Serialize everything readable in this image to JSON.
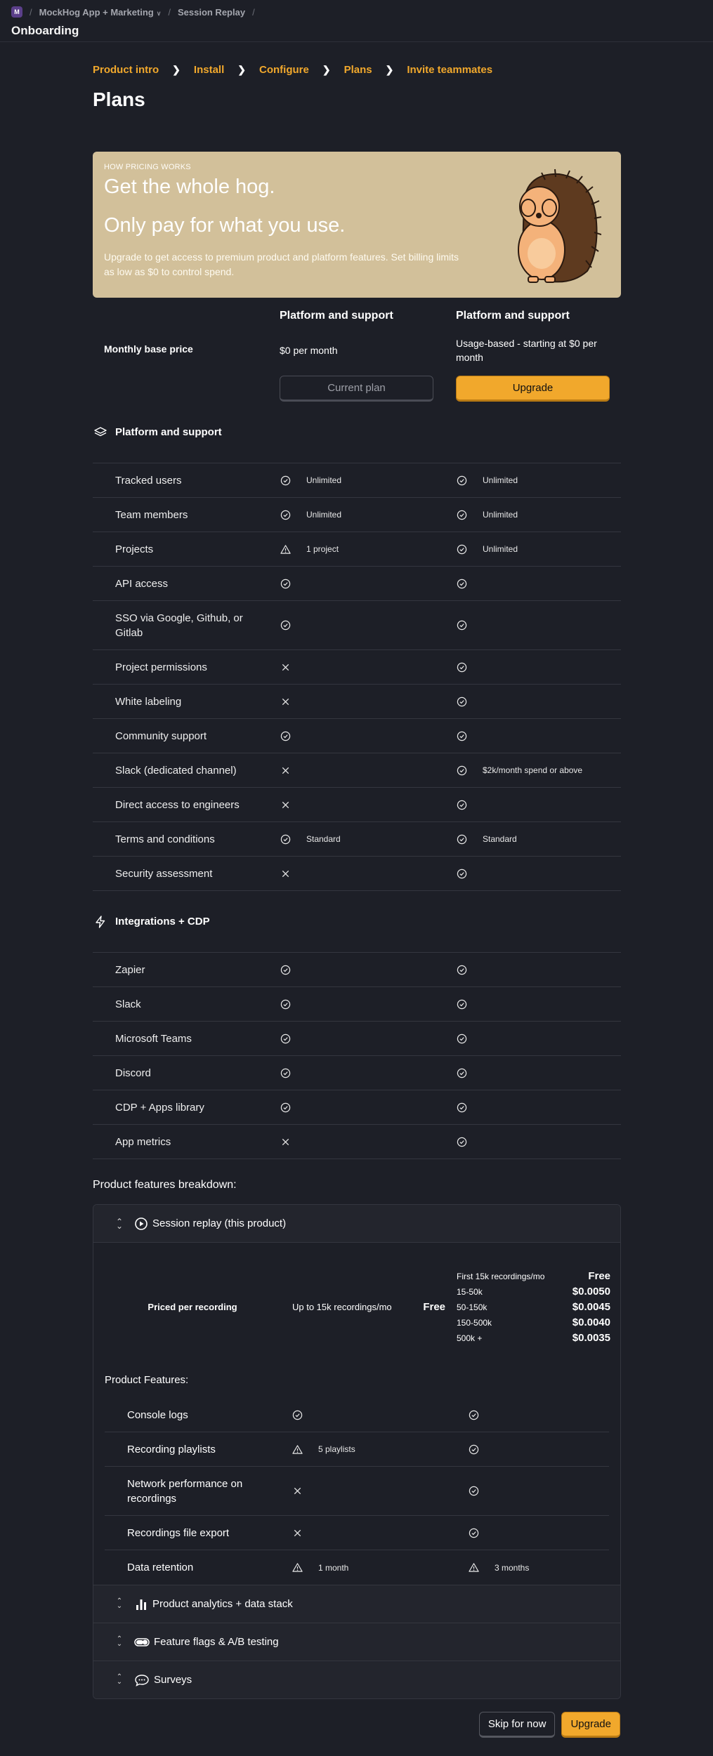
{
  "topbar": {
    "org_initial": "M",
    "breadcrumbs": [
      "MockHog App + Marketing",
      "Session Replay"
    ],
    "page_title": "Onboarding"
  },
  "steps": [
    "Product intro",
    "Install",
    "Configure",
    "Plans",
    "Invite teammates"
  ],
  "title": "Plans",
  "hero": {
    "eyebrow": "HOW PRICING WORKS",
    "headline1": "Get the whole hog.",
    "headline2": "Only pay for what you use.",
    "description": "Upgrade to get access to premium product and platform features. Set billing limits as low as $0 to control spend."
  },
  "plans": {
    "columns": [
      "Platform and support",
      "Platform and support"
    ],
    "base_price_label": "Monthly base price",
    "prices": [
      "$0 per month",
      "Usage-based - starting at $0 per month"
    ],
    "current_label": "Current plan",
    "upgrade_label": "Upgrade"
  },
  "sections": [
    {
      "title": "Platform and support",
      "icon": "stack-icon",
      "rows": [
        {
          "name": "Tracked users",
          "free": {
            "icon": "check",
            "text": "Unlimited"
          },
          "paid": {
            "icon": "check",
            "text": "Unlimited"
          }
        },
        {
          "name": "Team members",
          "free": {
            "icon": "check",
            "text": "Unlimited"
          },
          "paid": {
            "icon": "check",
            "text": "Unlimited"
          }
        },
        {
          "name": "Projects",
          "free": {
            "icon": "warning",
            "text": "1 project"
          },
          "paid": {
            "icon": "check",
            "text": "Unlimited"
          }
        },
        {
          "name": "API access",
          "free": {
            "icon": "check",
            "text": ""
          },
          "paid": {
            "icon": "check",
            "text": ""
          }
        },
        {
          "name": "SSO via Google, Github, or Gitlab",
          "free": {
            "icon": "check",
            "text": ""
          },
          "paid": {
            "icon": "check",
            "text": ""
          }
        },
        {
          "name": "Project permissions",
          "free": {
            "icon": "x",
            "text": ""
          },
          "paid": {
            "icon": "check",
            "text": ""
          }
        },
        {
          "name": "White labeling",
          "free": {
            "icon": "x",
            "text": ""
          },
          "paid": {
            "icon": "check",
            "text": ""
          }
        },
        {
          "name": "Community support",
          "free": {
            "icon": "check",
            "text": ""
          },
          "paid": {
            "icon": "check",
            "text": ""
          }
        },
        {
          "name": "Slack (dedicated channel)",
          "free": {
            "icon": "x",
            "text": ""
          },
          "paid": {
            "icon": "check",
            "text": "$2k/month spend or above"
          }
        },
        {
          "name": "Direct access to engineers",
          "free": {
            "icon": "x",
            "text": ""
          },
          "paid": {
            "icon": "check",
            "text": ""
          }
        },
        {
          "name": "Terms and conditions",
          "free": {
            "icon": "check",
            "text": "Standard"
          },
          "paid": {
            "icon": "check",
            "text": "Standard"
          }
        },
        {
          "name": "Security assessment",
          "free": {
            "icon": "x",
            "text": ""
          },
          "paid": {
            "icon": "check",
            "text": ""
          }
        }
      ]
    },
    {
      "title": "Integrations + CDP",
      "icon": "lightning-icon",
      "rows": [
        {
          "name": "Zapier",
          "free": {
            "icon": "check",
            "text": ""
          },
          "paid": {
            "icon": "check",
            "text": ""
          }
        },
        {
          "name": "Slack",
          "free": {
            "icon": "check",
            "text": ""
          },
          "paid": {
            "icon": "check",
            "text": ""
          }
        },
        {
          "name": "Microsoft Teams",
          "free": {
            "icon": "check",
            "text": ""
          },
          "paid": {
            "icon": "check",
            "text": ""
          }
        },
        {
          "name": "Discord",
          "free": {
            "icon": "check",
            "text": ""
          },
          "paid": {
            "icon": "check",
            "text": ""
          }
        },
        {
          "name": "CDP + Apps library",
          "free": {
            "icon": "check",
            "text": ""
          },
          "paid": {
            "icon": "check",
            "text": ""
          }
        },
        {
          "name": "App metrics",
          "free": {
            "icon": "x",
            "text": ""
          },
          "paid": {
            "icon": "check",
            "text": ""
          }
        }
      ]
    }
  ],
  "breakdown": {
    "title": "Product features breakdown:",
    "expanded": {
      "title": "Session replay (this product)",
      "priced_label": "Priced per recording",
      "free_tier": "Up to 15k recordings/mo",
      "free_price": "Free",
      "tiers": [
        {
          "range": "First 15k recordings/mo",
          "price": "Free"
        },
        {
          "range": "15-50k",
          "price": "$0.0050"
        },
        {
          "range": "50-150k",
          "price": "$0.0045"
        },
        {
          "range": "150-500k",
          "price": "$0.0040"
        },
        {
          "range": "500k +",
          "price": "$0.0035"
        }
      ],
      "features_label": "Product Features:",
      "features": [
        {
          "name": "Console logs",
          "free": {
            "icon": "check",
            "text": ""
          },
          "paid": {
            "icon": "check",
            "text": ""
          }
        },
        {
          "name": "Recording playlists",
          "free": {
            "icon": "warning",
            "text": "5 playlists"
          },
          "paid": {
            "icon": "check",
            "text": ""
          }
        },
        {
          "name": "Network performance on recordings",
          "free": {
            "icon": "x",
            "text": ""
          },
          "paid": {
            "icon": "check",
            "text": ""
          }
        },
        {
          "name": "Recordings file export",
          "free": {
            "icon": "x",
            "text": ""
          },
          "paid": {
            "icon": "check",
            "text": ""
          }
        },
        {
          "name": "Data retention",
          "free": {
            "icon": "warning",
            "text": "1 month"
          },
          "paid": {
            "icon": "warning",
            "text": "3 months"
          }
        }
      ]
    },
    "collapsed": [
      {
        "title": "Product analytics + data stack",
        "icon": "bar-chart-icon"
      },
      {
        "title": "Feature flags & A/B testing",
        "icon": "toggle-icon"
      },
      {
        "title": "Surveys",
        "icon": "chat-bubble-icon"
      }
    ]
  },
  "footer": {
    "skip_label": "Skip for now",
    "upgrade_label": "Upgrade"
  },
  "colors": {
    "accent": "#f1a82c",
    "background": "#1d1f27",
    "hero": "#d2c09a"
  }
}
